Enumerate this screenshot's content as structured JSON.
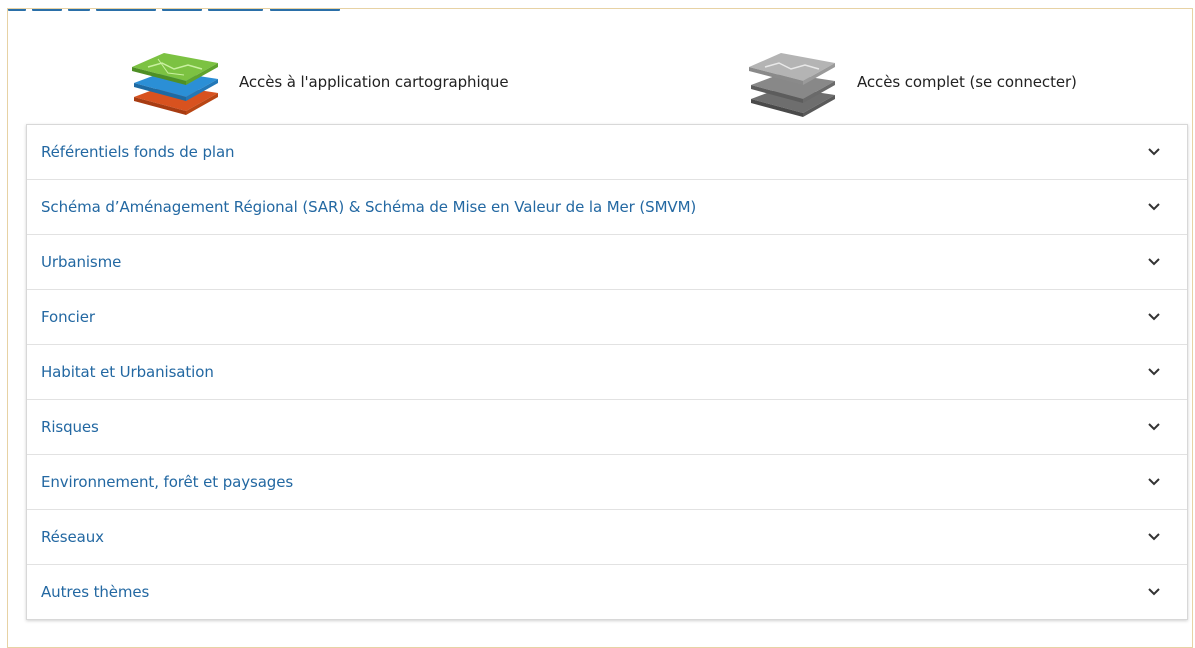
{
  "access_links": {
    "carto": {
      "label": "Accès à l'application cartographique",
      "icon": "map-layers-icon"
    },
    "full": {
      "label": "Accès complet (se connecter)",
      "icon": "map-layers-gray-icon"
    }
  },
  "accordion": {
    "items": [
      {
        "label": "Référentiels fonds de plan"
      },
      {
        "label": "Schéma d’Aménagement Régional (SAR) & Schéma de Mise en Valeur de la Mer (SMVM)"
      },
      {
        "label": "Urbanisme"
      },
      {
        "label": "Foncier"
      },
      {
        "label": "Habitat et Urbanisation"
      },
      {
        "label": "Risques"
      },
      {
        "label": "Environnement, forêt et paysages"
      },
      {
        "label": "Réseaux"
      },
      {
        "label": "Autres thèmes"
      }
    ],
    "expand_icon": "chevron-down-icon"
  },
  "colors": {
    "link": "#2368a2",
    "panel_border": "#e7d2a4",
    "heading": "#2a6fa8"
  }
}
